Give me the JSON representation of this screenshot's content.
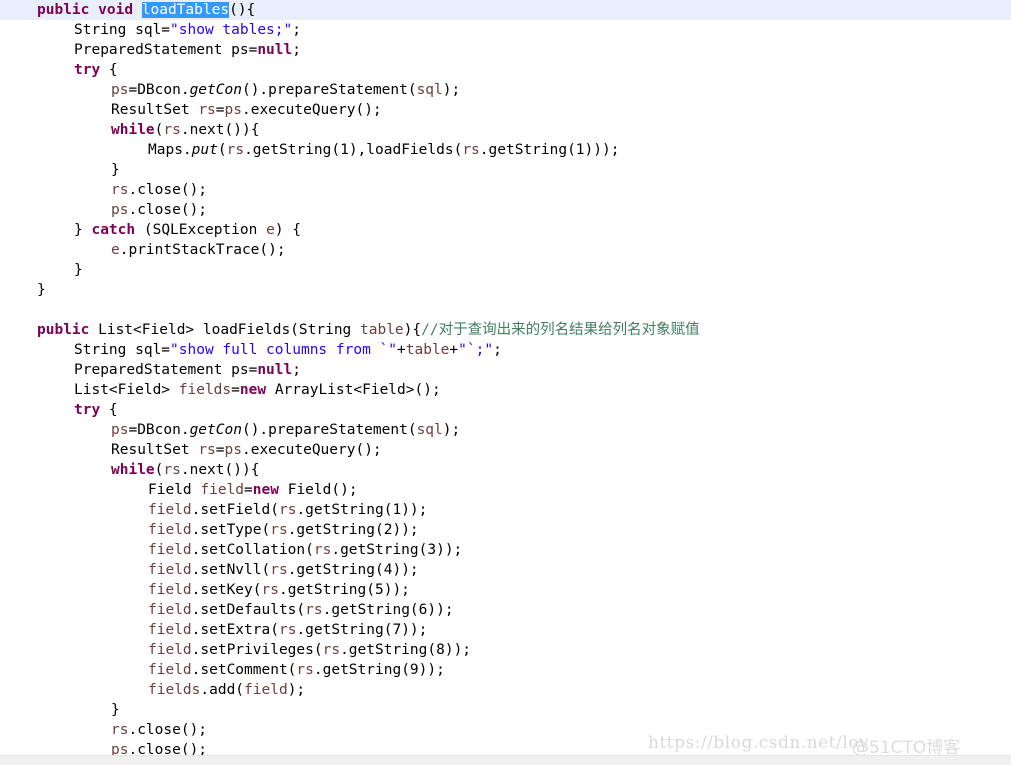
{
  "editor": {
    "language": "java",
    "current_line_index": 0,
    "selection_token": "loadTables",
    "colors": {
      "background": "#ffffff",
      "keyword": "#7f0055",
      "string": "#2a00ff",
      "comment": "#3f7f5f",
      "variable": "#6a3e3e",
      "plain": "#000000",
      "selection_background": "#3399ff",
      "selection_foreground": "#ffffff",
      "current_line_background": "#e9eefb",
      "scrollbar_track": "#f0f0f0",
      "watermark": "#d9d9d9"
    },
    "lines": [
      {
        "indent": 1,
        "current": true,
        "tokens": [
          {
            "t": "public",
            "c": "kw"
          },
          {
            "t": " ",
            "c": "pln"
          },
          {
            "t": "void",
            "c": "kw"
          },
          {
            "t": " ",
            "c": "pln"
          },
          {
            "t": "loadTables",
            "c": "sel"
          },
          {
            "t": "(){",
            "c": "pln"
          }
        ]
      },
      {
        "indent": 2,
        "current": false,
        "tokens": [
          {
            "t": "String sql=",
            "c": "pln"
          },
          {
            "t": "\"show tables;\"",
            "c": "str"
          },
          {
            "t": ";",
            "c": "pln"
          }
        ]
      },
      {
        "indent": 2,
        "current": false,
        "tokens": [
          {
            "t": "PreparedStatement ps=",
            "c": "pln"
          },
          {
            "t": "null",
            "c": "kw"
          },
          {
            "t": ";",
            "c": "pln"
          }
        ]
      },
      {
        "indent": 2,
        "current": false,
        "tokens": [
          {
            "t": "try",
            "c": "kw"
          },
          {
            "t": " {",
            "c": "pln"
          }
        ]
      },
      {
        "indent": 3,
        "current": false,
        "tokens": [
          {
            "t": "ps",
            "c": "var"
          },
          {
            "t": "=DBcon.",
            "c": "pln"
          },
          {
            "t": "getCon",
            "c": "stat"
          },
          {
            "t": "().prepareStatement(",
            "c": "pln"
          },
          {
            "t": "sql",
            "c": "var"
          },
          {
            "t": ");",
            "c": "pln"
          }
        ]
      },
      {
        "indent": 3,
        "current": false,
        "tokens": [
          {
            "t": "ResultSet ",
            "c": "pln"
          },
          {
            "t": "rs",
            "c": "var"
          },
          {
            "t": "=",
            "c": "pln"
          },
          {
            "t": "ps",
            "c": "var"
          },
          {
            "t": ".executeQuery();",
            "c": "pln"
          }
        ]
      },
      {
        "indent": 3,
        "current": false,
        "tokens": [
          {
            "t": "while",
            "c": "kw"
          },
          {
            "t": "(",
            "c": "pln"
          },
          {
            "t": "rs",
            "c": "var"
          },
          {
            "t": ".next()){",
            "c": "pln"
          }
        ]
      },
      {
        "indent": 4,
        "current": false,
        "tokens": [
          {
            "t": "Maps.",
            "c": "pln"
          },
          {
            "t": "put",
            "c": "stat"
          },
          {
            "t": "(",
            "c": "pln"
          },
          {
            "t": "rs",
            "c": "var"
          },
          {
            "t": ".getString(1),loadFields(",
            "c": "pln"
          },
          {
            "t": "rs",
            "c": "var"
          },
          {
            "t": ".getString(1)));",
            "c": "pln"
          }
        ]
      },
      {
        "indent": 3,
        "current": false,
        "tokens": [
          {
            "t": "}",
            "c": "pln"
          }
        ]
      },
      {
        "indent": 3,
        "current": false,
        "tokens": [
          {
            "t": "rs",
            "c": "var"
          },
          {
            "t": ".close();",
            "c": "pln"
          }
        ]
      },
      {
        "indent": 3,
        "current": false,
        "tokens": [
          {
            "t": "ps",
            "c": "var"
          },
          {
            "t": ".close();",
            "c": "pln"
          }
        ]
      },
      {
        "indent": 2,
        "current": false,
        "tokens": [
          {
            "t": "} ",
            "c": "pln"
          },
          {
            "t": "catch",
            "c": "kw"
          },
          {
            "t": " (SQLException ",
            "c": "pln"
          },
          {
            "t": "e",
            "c": "var"
          },
          {
            "t": ") {",
            "c": "pln"
          }
        ]
      },
      {
        "indent": 3,
        "current": false,
        "tokens": [
          {
            "t": "e",
            "c": "var"
          },
          {
            "t": ".printStackTrace();",
            "c": "pln"
          }
        ]
      },
      {
        "indent": 2,
        "current": false,
        "tokens": [
          {
            "t": "}",
            "c": "pln"
          }
        ]
      },
      {
        "indent": 1,
        "current": false,
        "tokens": [
          {
            "t": "}",
            "c": "pln"
          }
        ]
      },
      {
        "indent": 0,
        "current": false,
        "tokens": []
      },
      {
        "indent": 1,
        "current": false,
        "tokens": [
          {
            "t": "public",
            "c": "kw"
          },
          {
            "t": " List<Field> loadFields(String ",
            "c": "pln"
          },
          {
            "t": "table",
            "c": "var"
          },
          {
            "t": "){",
            "c": "pln"
          },
          {
            "t": "//对于查询出来的列名结果给列名对象赋值",
            "c": "cmt"
          }
        ]
      },
      {
        "indent": 2,
        "current": false,
        "tokens": [
          {
            "t": "String sql=",
            "c": "pln"
          },
          {
            "t": "\"show full columns from `\"",
            "c": "str"
          },
          {
            "t": "+",
            "c": "pln"
          },
          {
            "t": "table",
            "c": "var"
          },
          {
            "t": "+",
            "c": "pln"
          },
          {
            "t": "\"`;\"",
            "c": "str"
          },
          {
            "t": ";",
            "c": "pln"
          }
        ]
      },
      {
        "indent": 2,
        "current": false,
        "tokens": [
          {
            "t": "PreparedStatement ps=",
            "c": "pln"
          },
          {
            "t": "null",
            "c": "kw"
          },
          {
            "t": ";",
            "c": "pln"
          }
        ]
      },
      {
        "indent": 2,
        "current": false,
        "tokens": [
          {
            "t": "List<Field> ",
            "c": "pln"
          },
          {
            "t": "fields",
            "c": "var"
          },
          {
            "t": "=",
            "c": "pln"
          },
          {
            "t": "new",
            "c": "kw"
          },
          {
            "t": " ArrayList<Field>();",
            "c": "pln"
          }
        ]
      },
      {
        "indent": 2,
        "current": false,
        "tokens": [
          {
            "t": "try",
            "c": "kw"
          },
          {
            "t": " {",
            "c": "pln"
          }
        ]
      },
      {
        "indent": 3,
        "current": false,
        "tokens": [
          {
            "t": "ps",
            "c": "var"
          },
          {
            "t": "=DBcon.",
            "c": "pln"
          },
          {
            "t": "getCon",
            "c": "stat"
          },
          {
            "t": "().prepareStatement(",
            "c": "pln"
          },
          {
            "t": "sql",
            "c": "var"
          },
          {
            "t": ");",
            "c": "pln"
          }
        ]
      },
      {
        "indent": 3,
        "current": false,
        "tokens": [
          {
            "t": "ResultSet ",
            "c": "pln"
          },
          {
            "t": "rs",
            "c": "var"
          },
          {
            "t": "=",
            "c": "pln"
          },
          {
            "t": "ps",
            "c": "var"
          },
          {
            "t": ".executeQuery();",
            "c": "pln"
          }
        ]
      },
      {
        "indent": 3,
        "current": false,
        "tokens": [
          {
            "t": "while",
            "c": "kw"
          },
          {
            "t": "(",
            "c": "pln"
          },
          {
            "t": "rs",
            "c": "var"
          },
          {
            "t": ".next()){",
            "c": "pln"
          }
        ]
      },
      {
        "indent": 4,
        "current": false,
        "tokens": [
          {
            "t": "Field ",
            "c": "pln"
          },
          {
            "t": "field",
            "c": "var"
          },
          {
            "t": "=",
            "c": "pln"
          },
          {
            "t": "new",
            "c": "kw"
          },
          {
            "t": " Field();",
            "c": "pln"
          }
        ]
      },
      {
        "indent": 4,
        "current": false,
        "tokens": [
          {
            "t": "field",
            "c": "var"
          },
          {
            "t": ".setField(",
            "c": "pln"
          },
          {
            "t": "rs",
            "c": "var"
          },
          {
            "t": ".getString(1));",
            "c": "pln"
          }
        ]
      },
      {
        "indent": 4,
        "current": false,
        "tokens": [
          {
            "t": "field",
            "c": "var"
          },
          {
            "t": ".setType(",
            "c": "pln"
          },
          {
            "t": "rs",
            "c": "var"
          },
          {
            "t": ".getString(2));",
            "c": "pln"
          }
        ]
      },
      {
        "indent": 4,
        "current": false,
        "tokens": [
          {
            "t": "field",
            "c": "var"
          },
          {
            "t": ".setCollation(",
            "c": "pln"
          },
          {
            "t": "rs",
            "c": "var"
          },
          {
            "t": ".getString(3));",
            "c": "pln"
          }
        ]
      },
      {
        "indent": 4,
        "current": false,
        "tokens": [
          {
            "t": "field",
            "c": "var"
          },
          {
            "t": ".setNvll(",
            "c": "pln"
          },
          {
            "t": "rs",
            "c": "var"
          },
          {
            "t": ".getString(4));",
            "c": "pln"
          }
        ]
      },
      {
        "indent": 4,
        "current": false,
        "tokens": [
          {
            "t": "field",
            "c": "var"
          },
          {
            "t": ".setKey(",
            "c": "pln"
          },
          {
            "t": "rs",
            "c": "var"
          },
          {
            "t": ".getString(5));",
            "c": "pln"
          }
        ]
      },
      {
        "indent": 4,
        "current": false,
        "tokens": [
          {
            "t": "field",
            "c": "var"
          },
          {
            "t": ".setDefaults(",
            "c": "pln"
          },
          {
            "t": "rs",
            "c": "var"
          },
          {
            "t": ".getString(6));",
            "c": "pln"
          }
        ]
      },
      {
        "indent": 4,
        "current": false,
        "tokens": [
          {
            "t": "field",
            "c": "var"
          },
          {
            "t": ".setExtra(",
            "c": "pln"
          },
          {
            "t": "rs",
            "c": "var"
          },
          {
            "t": ".getString(7));",
            "c": "pln"
          }
        ]
      },
      {
        "indent": 4,
        "current": false,
        "tokens": [
          {
            "t": "field",
            "c": "var"
          },
          {
            "t": ".setPrivileges(",
            "c": "pln"
          },
          {
            "t": "rs",
            "c": "var"
          },
          {
            "t": ".getString(8));",
            "c": "pln"
          }
        ]
      },
      {
        "indent": 4,
        "current": false,
        "tokens": [
          {
            "t": "field",
            "c": "var"
          },
          {
            "t": ".setComment(",
            "c": "pln"
          },
          {
            "t": "rs",
            "c": "var"
          },
          {
            "t": ".getString(9));",
            "c": "pln"
          }
        ]
      },
      {
        "indent": 4,
        "current": false,
        "tokens": [
          {
            "t": "fields",
            "c": "var"
          },
          {
            "t": ".add(",
            "c": "pln"
          },
          {
            "t": "field",
            "c": "var"
          },
          {
            "t": ");",
            "c": "pln"
          }
        ]
      },
      {
        "indent": 3,
        "current": false,
        "tokens": [
          {
            "t": "}",
            "c": "pln"
          }
        ]
      },
      {
        "indent": 3,
        "current": false,
        "tokens": [
          {
            "t": "rs",
            "c": "var"
          },
          {
            "t": ".close();",
            "c": "pln"
          }
        ]
      },
      {
        "indent": 3,
        "current": false,
        "tokens": [
          {
            "t": "ps",
            "c": "var"
          },
          {
            "t": ".close();",
            "c": "pln"
          }
        ]
      }
    ]
  },
  "watermarks": {
    "url": "https://blog.csdn.net/lov",
    "brand": "@51CTO博客"
  },
  "scrollbar": {
    "orientation": "horizontal",
    "thumb_visible": false
  }
}
